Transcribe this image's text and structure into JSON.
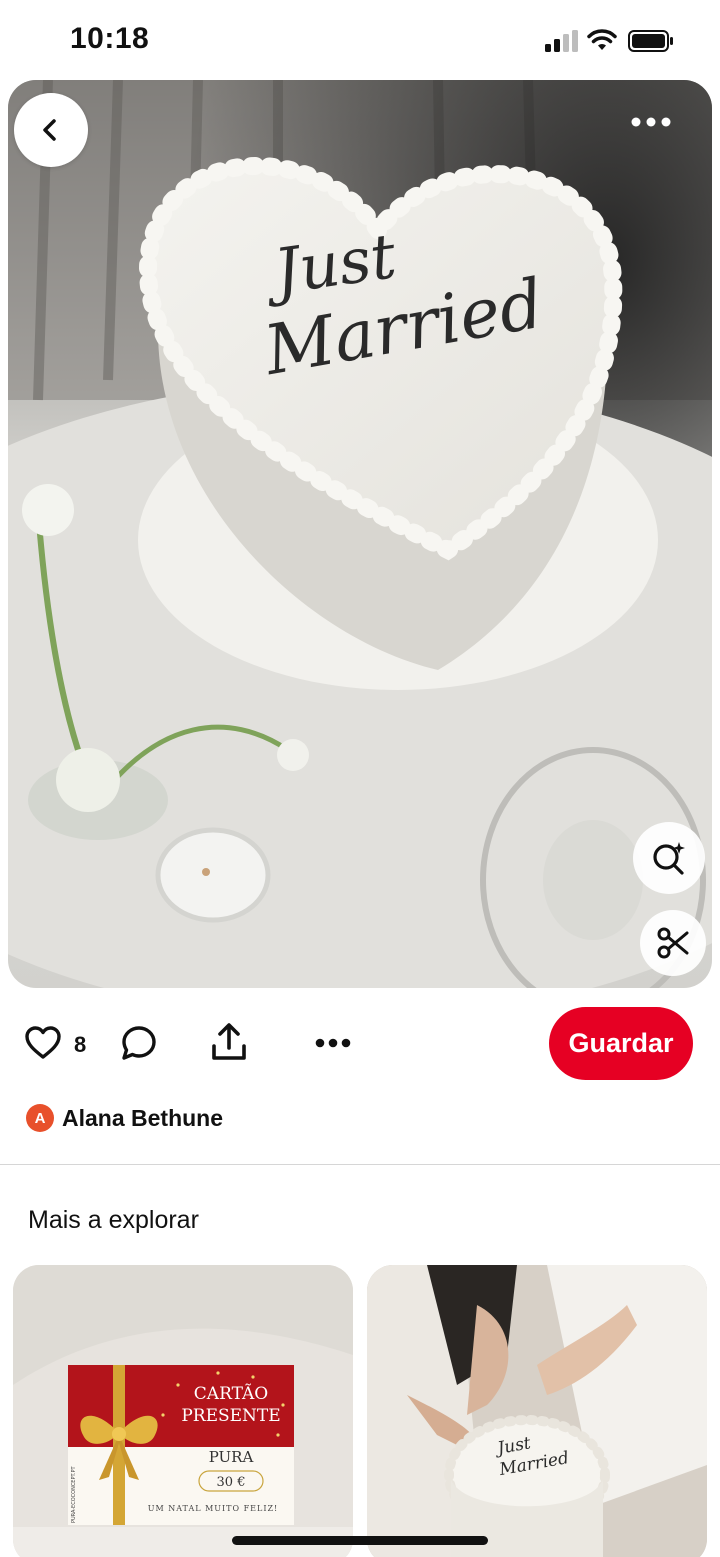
{
  "status_bar": {
    "time": "10:18"
  },
  "pin": {
    "image_text": [
      "Just",
      "Married"
    ],
    "like_count": "8",
    "save_label": "Guardar",
    "author": {
      "initial": "A",
      "name": "Alana Bethune"
    }
  },
  "explore": {
    "title": "Mais a explorar",
    "cards": [
      {
        "card_title_line1": "CARTÃO",
        "card_title_line2": "PRESENTE",
        "brand": "PURA",
        "price": "30 €",
        "footer": "UM NATAL MUITO FELIZ!",
        "side_text": "PURA-ECOCONCEPT.PT"
      },
      {
        "cake_text": [
          "Just",
          "Married"
        ]
      }
    ]
  },
  "colors": {
    "accent": "#e60023",
    "avatar": "#e8502b"
  },
  "icons": [
    "chevron-left-icon",
    "more-icon",
    "visual-search-icon",
    "scissors-icon",
    "heart-icon",
    "comment-icon",
    "share-icon",
    "signal-icon",
    "wifi-icon",
    "battery-icon"
  ]
}
